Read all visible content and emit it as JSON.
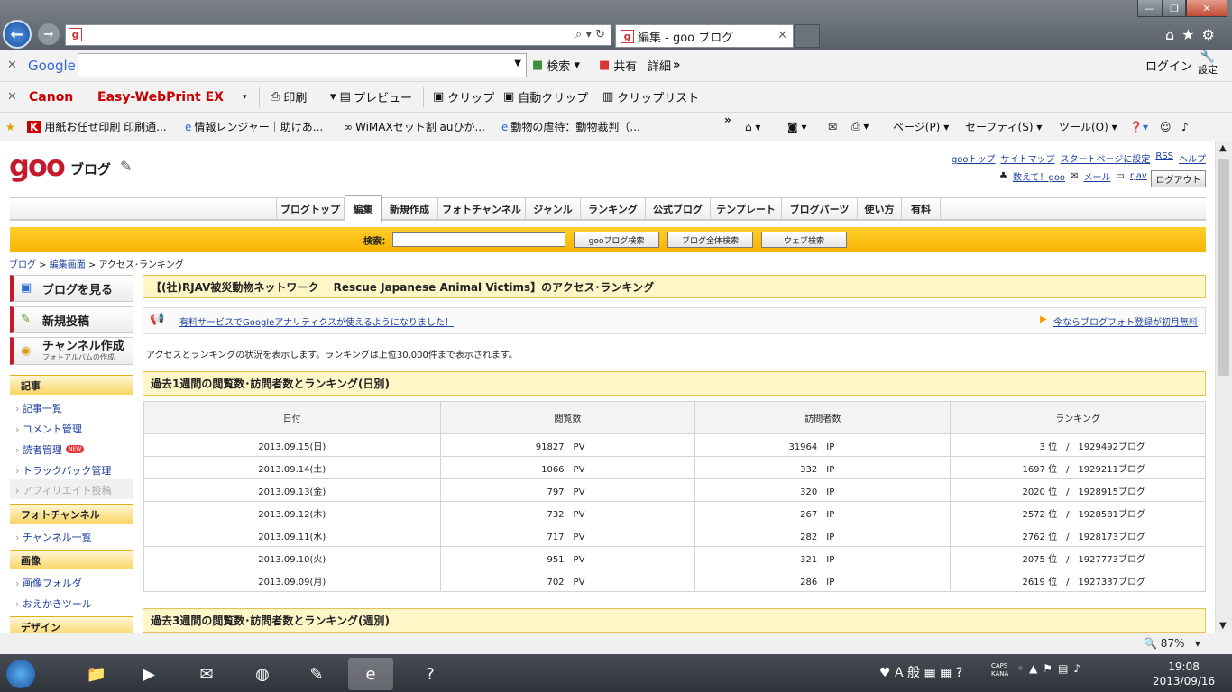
{
  "window": {
    "tab_title": "編集 - goo ブログ",
    "minimize": "—",
    "maximize": "❐",
    "close": "✕"
  },
  "toolbar_google": {
    "brand": "Google",
    "search_btn": "検索",
    "share_btn": "共有",
    "details_btn": "詳細",
    "more": "»",
    "login": "ログイン",
    "settings": "設定"
  },
  "toolbar_canon": {
    "brand": "Canon",
    "product": "Easy-WebPrint EX",
    "print": "印刷",
    "preview": "プレビュー",
    "clip": "クリップ",
    "auto_clip": "自動クリップ",
    "clip_list": "クリップリスト"
  },
  "favorites": {
    "items": [
      "用紙お任せ印刷 印刷通...",
      "情報レンジャー｜助けあ...",
      "WiMAXセット割 auひか...",
      "動物の虐待：動物裁判（..."
    ],
    "more": "»",
    "page": "ページ(P)",
    "safety": "セーフティ(S)",
    "tools": "ツール(O)"
  },
  "goo": {
    "logo": "goo",
    "blog": "ブログ",
    "header_links": [
      "gooトップ",
      "サイトマップ",
      "スタートページに設定",
      "RSS",
      "ヘルプ"
    ],
    "count_label": "数えて！goo",
    "mail": "メール",
    "user": "rjav",
    "logout": "ログアウト",
    "nav": [
      "ブログトップ",
      "編集",
      "新規作成",
      "フォトチャンネル",
      "ジャンル",
      "ランキング",
      "公式ブログ",
      "テンプレート",
      "ブログパーツ",
      "使い方",
      "有料"
    ],
    "search_label": "検索：",
    "search_btns": [
      "gooブログ検索",
      "ブログ全体検索",
      "ウェブ検索"
    ],
    "breadcrumb": [
      "ブログ",
      "編集画面",
      "アクセス･ランキング"
    ]
  },
  "sidebar": {
    "view_blog": "ブログを見る",
    "new_post": "新規投稿",
    "channel_create": "チャンネル作成",
    "channel_sub": "フォトアルバムの作成",
    "sections": [
      {
        "title": "記事",
        "items": [
          "記事一覧",
          "コメント管理",
          "読者管理",
          "トラックバック管理",
          "アフィリエイト投稿"
        ]
      },
      {
        "title": "フォトチャンネル",
        "items": [
          "チャンネル一覧"
        ]
      },
      {
        "title": "画像",
        "items": [
          "画像フォルダ",
          "おえかきツール"
        ]
      },
      {
        "title": "デザイン",
        "items": []
      }
    ],
    "new_badge": "NEW"
  },
  "main": {
    "title": "【(社)RJAV被災動物ネットワーク　 Rescue Japanese Animal Victims】のアクセス･ランキング",
    "notice": "有料サービスでGoogleアナリティクスが使えるようになりました！",
    "notice_right": "今ならブログフォト登録が初月無料",
    "description": "アクセスとランキングの状況を表示します。ランキングは上位30,000件まで表示されます。",
    "daily_title": "過去1週間の閲覧数･訪問者数とランキング(日別)",
    "weekly_title": "過去3週間の閲覧数･訪問者数とランキング(週別)",
    "columns": [
      "日付",
      "閲覧数",
      "訪問者数",
      "ランキング"
    ],
    "rows": [
      [
        "2013.09.15(日)",
        "91827　PV",
        "31964　IP",
        "3 位　/　1929492ブログ"
      ],
      [
        "2013.09.14(土)",
        "1066　PV",
        "332　IP",
        "1697 位　/　1929211ブログ"
      ],
      [
        "2013.09.13(金)",
        "797　PV",
        "320　IP",
        "2020 位　/　1928915ブログ"
      ],
      [
        "2013.09.12(木)",
        "732　PV",
        "267　IP",
        "2572 位　/　1928581ブログ"
      ],
      [
        "2013.09.11(水)",
        "717　PV",
        "282　IP",
        "2762 位　/　1928173ブログ"
      ],
      [
        "2013.09.10(火)",
        "951　PV",
        "321　IP",
        "2075 位　/　1927773ブログ"
      ],
      [
        "2013.09.09(月)",
        "702　PV",
        "286　IP",
        "2619 位　/　1927337ブログ"
      ]
    ]
  },
  "statusbar": {
    "zoom": "87%"
  },
  "taskbar": {
    "ime": "A 般",
    "caps": "CAPS",
    "kana": "KANA",
    "time": "19:08",
    "date": "2013/09/16"
  }
}
